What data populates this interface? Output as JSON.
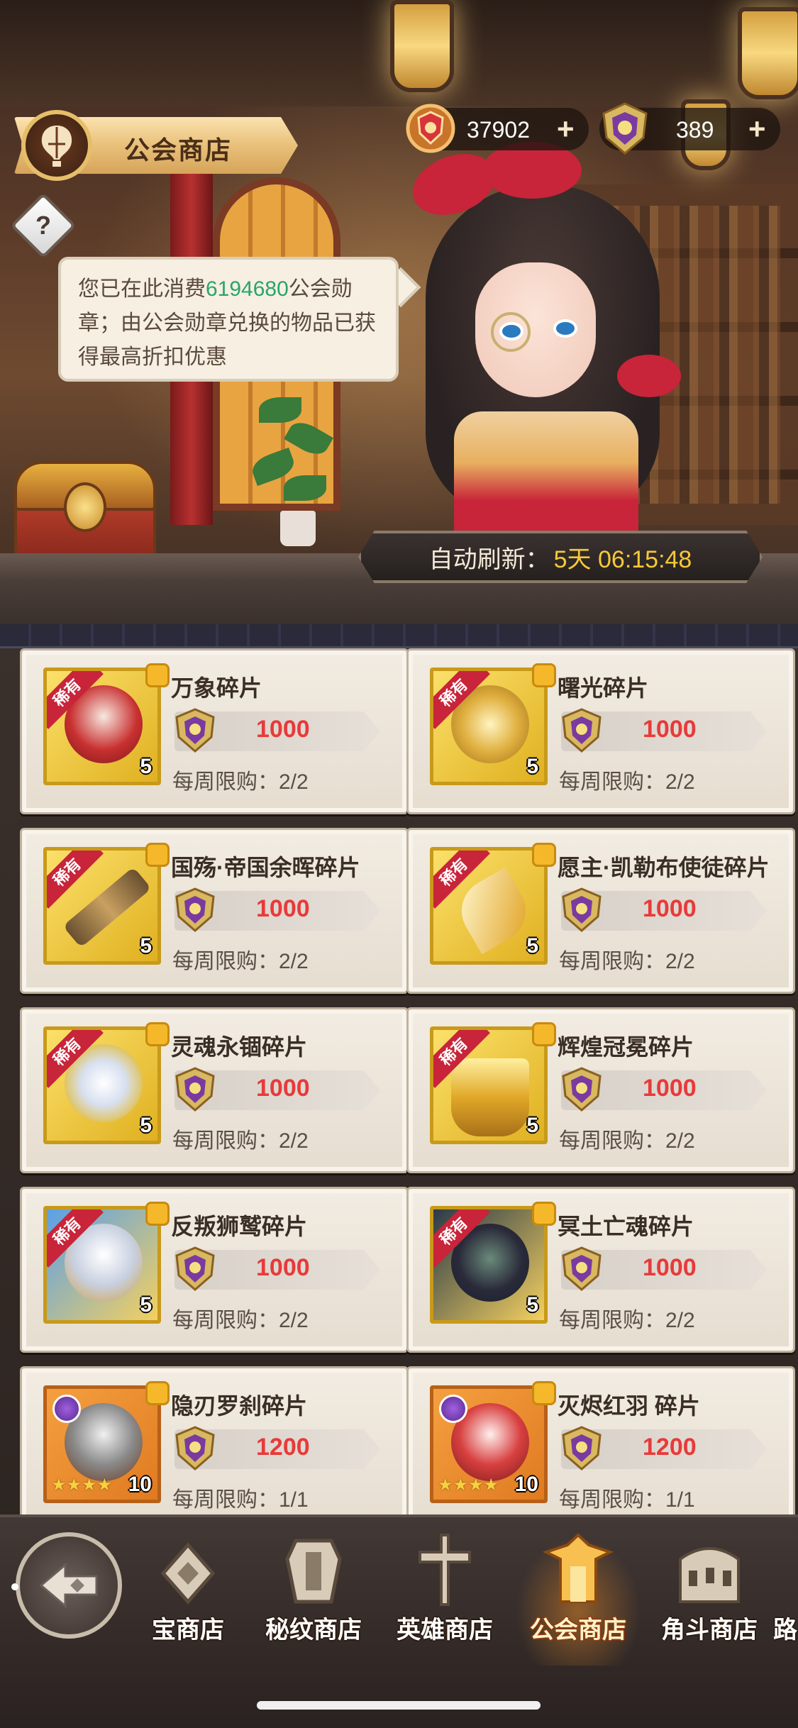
{
  "header": {
    "title": "公会商店",
    "currencies": [
      {
        "icon": "guild-badge-icon",
        "value": "37902"
      },
      {
        "icon": "guild-medal-icon",
        "value": "389"
      }
    ],
    "plus_symbol": "+"
  },
  "notice": {
    "prefix": "您已在此消费",
    "amount": "6194680",
    "suffix": "公会勋章；由公会勋章兑换的物品已获得最高折扣优惠"
  },
  "refresh": {
    "label": "自动刷新：",
    "time": "5天 06:15:48"
  },
  "items": [
    {
      "name": "万象碎片",
      "price": "1000",
      "limit": "每周限购：2/2",
      "rarity": "稀有",
      "qty": "5"
    },
    {
      "name": "曙光碎片",
      "price": "1000",
      "limit": "每周限购：2/2",
      "rarity": "稀有",
      "qty": "5"
    },
    {
      "name": "国殇·帝国余晖碎片",
      "price": "1000",
      "limit": "每周限购：2/2",
      "rarity": "稀有",
      "qty": "5"
    },
    {
      "name": "愿主·凯勒布使徒碎片",
      "price": "1000",
      "limit": "每周限购：2/2",
      "rarity": "稀有",
      "qty": "5"
    },
    {
      "name": "灵魂永锢碎片",
      "price": "1000",
      "limit": "每周限购：2/2",
      "rarity": "稀有",
      "qty": "5"
    },
    {
      "name": "辉煌冠冕碎片",
      "price": "1000",
      "limit": "每周限购：2/2",
      "rarity": "稀有",
      "qty": "5"
    },
    {
      "name": "反叛狮鹫碎片",
      "price": "1000",
      "limit": "每周限购：2/2",
      "rarity": "稀有",
      "qty": "5"
    },
    {
      "name": "冥土亡魂碎片",
      "price": "1000",
      "limit": "每周限购：2/2",
      "rarity": "稀有",
      "qty": "5"
    },
    {
      "name": "隐刃罗刹碎片",
      "price": "1200",
      "limit": "每周限购：1/1",
      "stars": "★★★★",
      "qty": "10"
    },
    {
      "name": "灭烬红羽 碎片",
      "price": "1200",
      "limit": "每周限购：1/1",
      "stars": "★★★★",
      "qty": "10"
    }
  ],
  "nav": {
    "tabs": [
      {
        "label": "宝商店"
      },
      {
        "label": "秘纹商店"
      },
      {
        "label": "英雄商店"
      },
      {
        "label": "公会商店"
      },
      {
        "label": "角斗商店"
      },
      {
        "label": "路"
      }
    ]
  },
  "colors": {
    "price": "#e83a3a",
    "notice_highlight": "#2aa46a",
    "refresh_time": "#f8c838",
    "rare_ribbon": "#c8243a"
  }
}
